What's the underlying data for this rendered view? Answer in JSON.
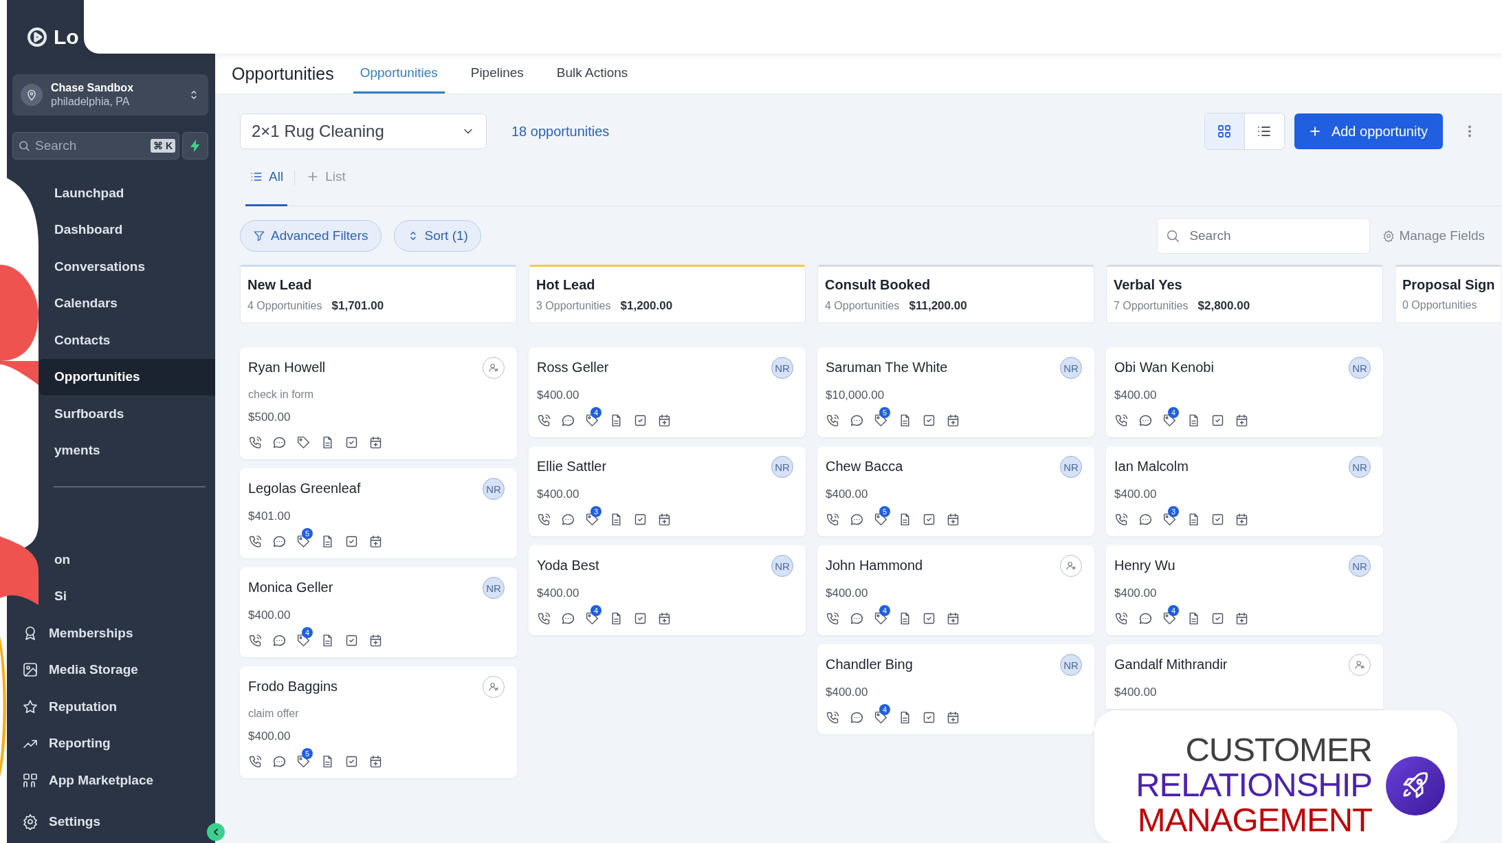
{
  "sidebar": {
    "logo_text": "Lo",
    "account": {
      "name": "Chase Sandbox",
      "location": "philadelphia, PA"
    },
    "search": {
      "placeholder": "Search",
      "shortcut": "⌘ K"
    },
    "items": [
      {
        "label": "Launchpad",
        "selected": false
      },
      {
        "label": "Dashboard",
        "selected": false
      },
      {
        "label": "Conversations",
        "selected": false
      },
      {
        "label": "Calendars",
        "selected": false
      },
      {
        "label": "Contacts",
        "selected": false
      },
      {
        "label": "Opportunities",
        "selected": true
      },
      {
        "label": "Surfboards",
        "selected": false
      },
      {
        "label": "yments",
        "selected": false
      }
    ],
    "items_2": [
      {
        "label": "on",
        "selected": false
      },
      {
        "label": "Si",
        "selected": false
      },
      {
        "label": "Memberships",
        "selected": false
      },
      {
        "label": "Media Storage",
        "selected": false
      },
      {
        "label": "Reputation",
        "selected": false
      },
      {
        "label": "Reporting",
        "selected": false
      },
      {
        "label": "App Marketplace",
        "selected": false
      }
    ],
    "settings": {
      "label": "Settings"
    }
  },
  "header": {
    "title": "Opportunities",
    "tabs": [
      {
        "label": "Opportunities",
        "selected": true
      },
      {
        "label": "Pipelines",
        "selected": false
      },
      {
        "label": "Bulk Actions",
        "selected": false
      }
    ]
  },
  "toolbar": {
    "pipeline": "2×1 Rug Cleaning",
    "count": "18 opportunities",
    "view_modes": [
      {
        "selected": true
      },
      {
        "selected": false
      }
    ],
    "add_button": "Add opportunity"
  },
  "views": [
    {
      "label": "All",
      "selected": true
    },
    {
      "label": "List",
      "selected": false
    }
  ],
  "filters": {
    "advanced": "Advanced Filters",
    "sort": "Sort (1)",
    "search_placeholder": "Search",
    "manage": "Manage Fields"
  },
  "columns": [
    {
      "title": "New Lead",
      "count": "4 Opportunities",
      "total": "$1,701.00",
      "color": "#c9dcf3",
      "cards": [
        {
          "kind": "full",
          "name": "Ryan Howell",
          "note": "check in form",
          "amount": "$500.00"
        },
        {
          "kind": "full",
          "name": "Legolas Greenleaf",
          "amount": "$401.00",
          "initials": "NR",
          "tags": "5"
        },
        {
          "kind": "full",
          "name": "Monica Geller",
          "amount": "$400.00",
          "initials": "NR",
          "tags": "4"
        },
        {
          "kind": "full",
          "name": "Frodo Baggins",
          "note": "claim offer",
          "amount": "$400.00",
          "tags": "5"
        }
      ]
    },
    {
      "title": "Hot Lead",
      "count": "3 Opportunities",
      "total": "$1,200.00",
      "color": "#f2c94c",
      "cards": [
        {
          "kind": "full",
          "name": "Ross Geller",
          "amount": "$400.00",
          "initials": "NR",
          "tags": "4"
        },
        {
          "kind": "full",
          "name": "Ellie Sattler",
          "amount": "$400.00",
          "initials": "NR",
          "tags": "3"
        },
        {
          "kind": "full",
          "name": "Yoda Best",
          "amount": "$400.00",
          "initials": "NR",
          "tags": "4"
        }
      ]
    },
    {
      "title": "Consult Booked",
      "count": "4 Opportunities",
      "total": "$11,200.00",
      "color": "#d5dbe3",
      "cards": [
        {
          "kind": "full",
          "name": "Saruman The White",
          "amount": "$10,000.00",
          "initials": "NR",
          "tags": "5"
        },
        {
          "kind": "full",
          "name": "Chew Bacca",
          "amount": "$400.00",
          "initials": "NR",
          "tags": "5"
        },
        {
          "kind": "full",
          "name": "John Hammond",
          "amount": "$400.00",
          "tags": "4"
        },
        {
          "kind": "full",
          "name": "Chandler Bing",
          "amount": "$400.00",
          "initials": "NR",
          "tags": "4"
        }
      ]
    },
    {
      "title": "Verbal Yes",
      "count": "7 Opportunities",
      "total": "$2,800.00",
      "color": "#d5dbe3",
      "cards": [
        {
          "kind": "full",
          "name": "Obi Wan Kenobi",
          "amount": "$400.00",
          "initials": "NR",
          "tags": "4"
        },
        {
          "kind": "full",
          "name": "Ian Malcolm",
          "amount": "$400.00",
          "initials": "NR",
          "tags": "3"
        },
        {
          "kind": "full",
          "name": "Henry Wu",
          "amount": "$400.00",
          "initials": "NR",
          "tags": "4"
        },
        {
          "kind": "partial",
          "name": "Gandalf Mithrandir",
          "amount": "$400.00"
        }
      ]
    },
    {
      "title": "Proposal Sign",
      "count": "0 Opportunities",
      "color": "#d5dbe3"
    }
  ],
  "promo": {
    "lines": [
      {
        "text": "CUSTOMER",
        "color": "#404040"
      },
      {
        "text": "RELATIONSHIP",
        "color": "#4b22b0"
      },
      {
        "text": "MANAGEMENT",
        "color": "#c00000"
      }
    ]
  }
}
